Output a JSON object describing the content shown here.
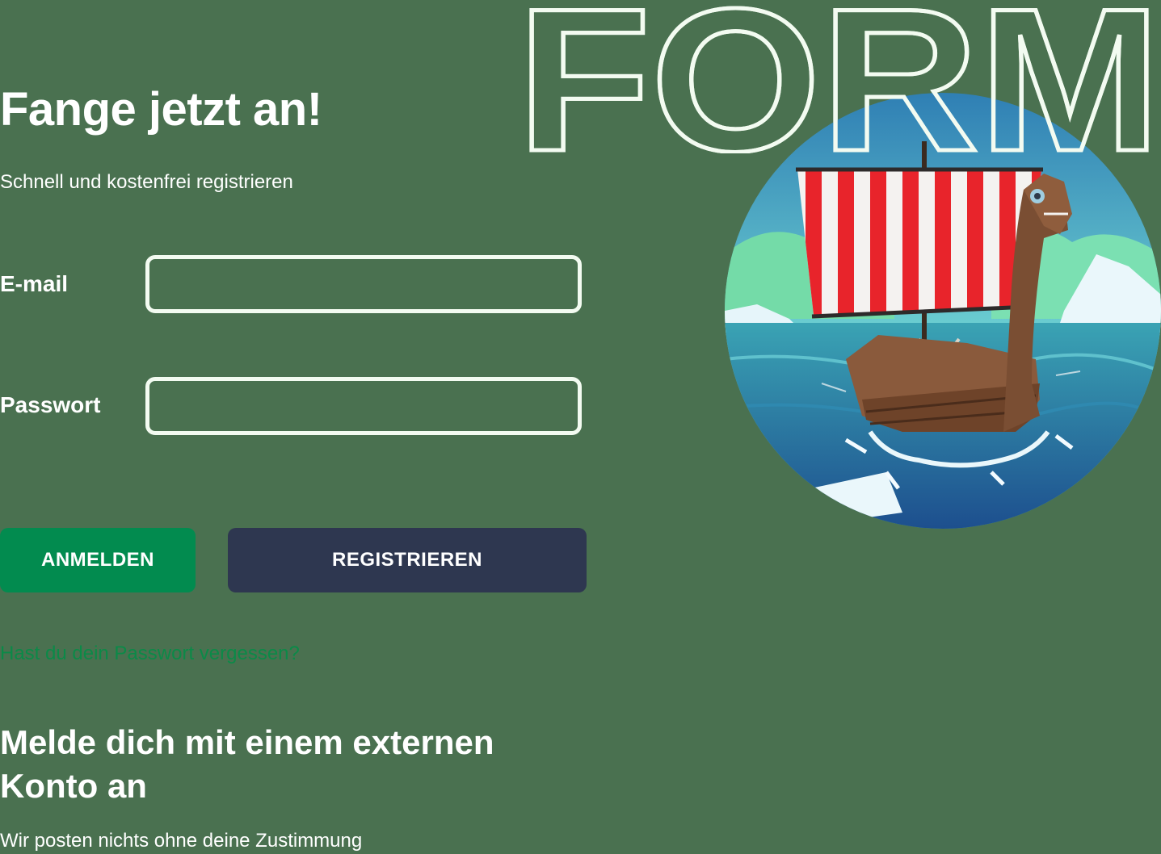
{
  "hero": {
    "word": "FORM",
    "illustration": "viking-ship-illustration"
  },
  "header": {
    "title": "Fange jetzt an!",
    "subtitle": "Schnell und kostenfrei registrieren"
  },
  "form": {
    "email_label": "E-mail",
    "email_value": "",
    "password_label": "Passwort",
    "password_value": ""
  },
  "actions": {
    "login_label": "ANMELDEN",
    "register_label": "REGISTRIEREN",
    "forgot_label": "Hast du dein Passwort vergessen?"
  },
  "external": {
    "title": "Melde dich mit einem externen Konto an",
    "note": "Wir posten nichts ohne deine Zustimmung"
  },
  "colors": {
    "background": "#4a7150",
    "login_button": "#028b4f",
    "register_button": "#2e3750",
    "link": "#0b8a48",
    "outline": "#f3fbf1"
  }
}
